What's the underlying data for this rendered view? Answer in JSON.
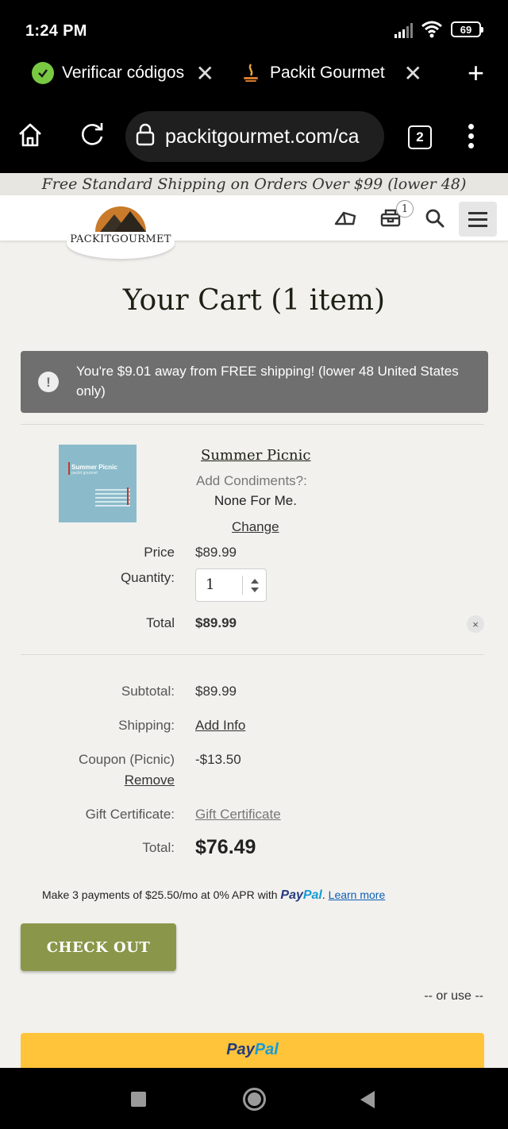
{
  "status": {
    "time": "1:24 PM",
    "battery": "69"
  },
  "tabs": [
    {
      "title": "Verificar códigos",
      "favicon": "check-circle-icon"
    },
    {
      "title": "Packit Gourmet -",
      "favicon": "campfire-icon"
    }
  ],
  "browser": {
    "url": "packitgourmet.com/ca",
    "tab_count": "2"
  },
  "site": {
    "promo": "Free Standard Shipping on Orders Over $99 (lower 48)",
    "logo_text": "PACKITGOURMET",
    "cart_badge": "1"
  },
  "cart": {
    "title": "Your Cart (1 item)",
    "alert": "You're $9.01 away from FREE shipping! (lower 48 United States only)",
    "item": {
      "thumb_title": "Summer Picnic",
      "thumb_subtitle": "packit gourmet",
      "name": "Summer Picnic",
      "option_label": "Add Condiments?:",
      "option_value": "None For Me.",
      "change_label": "Change",
      "price_label": "Price",
      "price": "$89.99",
      "qty_label": "Quantity:",
      "qty": "1",
      "total_label": "Total",
      "total": "$89.99",
      "remove_icon": "×"
    },
    "summary": {
      "subtotal_label": "Subtotal:",
      "subtotal": "$89.99",
      "shipping_label": "Shipping:",
      "shipping_link": "Add Info",
      "coupon_label": "Coupon (Picnic)",
      "coupon_value": "-$13.50",
      "coupon_remove": "Remove",
      "gift_label": "Gift Certificate:",
      "gift_link": "Gift Certificate",
      "total_label": "Total:",
      "total": "$76.49"
    },
    "paylater": {
      "text": "Make 3 payments of $25.50/mo at 0% APR with",
      "brand_pay": "Pay",
      "brand_pal": "Pal",
      "period": ".",
      "learn_more": "Learn more"
    },
    "checkout_label": "CHECK OUT",
    "or_use": "-- or use --",
    "paypal_pay": "Pay",
    "paypal_pal": "Pal"
  },
  "colors": {
    "checkout": "#8a974a",
    "alert": "#6f6f6f",
    "paypal_button": "#ffc439",
    "paypal_dark": "#253b80",
    "paypal_light": "#179bd7"
  }
}
